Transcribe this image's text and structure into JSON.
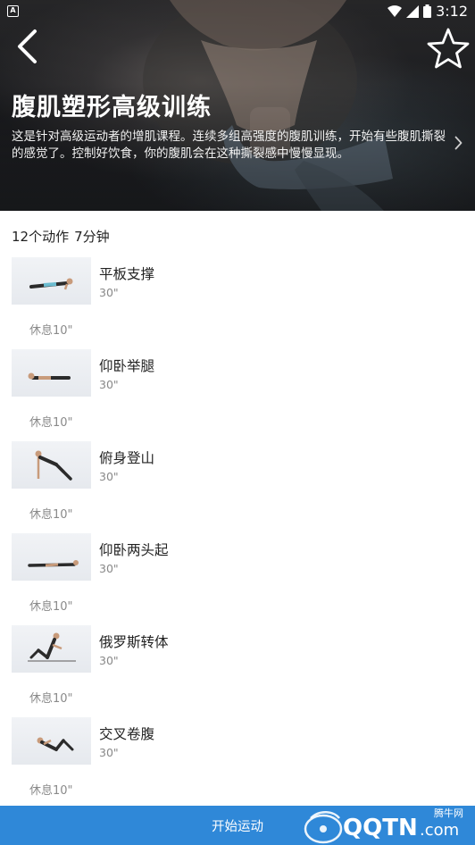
{
  "status_bar": {
    "time": "3:12",
    "notification_icon": "A",
    "icons": [
      "wifi-icon",
      "signal-icon",
      "battery-icon"
    ]
  },
  "header": {
    "title": "腹肌塑形高级训练",
    "description": "这是针对高级运动者的增肌课程。连续多组高强度的腹肌训练，开始有些腹肌撕裂的感觉了。控制好饮食，你的腹肌会在这种撕裂感中慢慢显现。"
  },
  "summary": {
    "count": "12个动作",
    "duration": "7分钟"
  },
  "exercises": [
    {
      "name": "平板支撑",
      "duration": "30\"",
      "rest": "休息10\""
    },
    {
      "name": "仰卧举腿",
      "duration": "30\"",
      "rest": "休息10\""
    },
    {
      "name": "俯身登山",
      "duration": "30\"",
      "rest": "休息10\""
    },
    {
      "name": "仰卧两头起",
      "duration": "30\"",
      "rest": "休息10\""
    },
    {
      "name": "俄罗斯转体",
      "duration": "30\"",
      "rest": "休息10\""
    },
    {
      "name": "交叉卷腹",
      "duration": "30\"",
      "rest": "休息10\""
    }
  ],
  "footer": {
    "start_label": "开始运动",
    "watermark_brand": "QQTN",
    "watermark_domain": ".com",
    "watermark_site": "腾牛网"
  },
  "colors": {
    "accent": "#2f88d8",
    "text_primary": "#222222",
    "text_secondary": "#888888"
  }
}
